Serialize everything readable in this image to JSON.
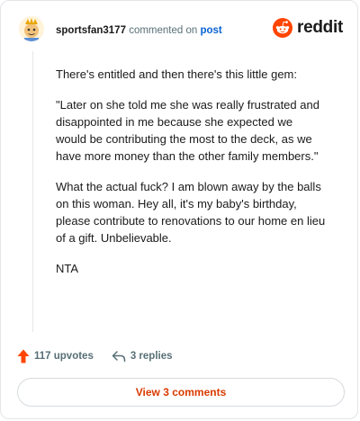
{
  "comment": {
    "author": "sportsfan3177",
    "action_text": "commented on",
    "target_link": "post",
    "paragraphs": [
      "There's entitled and then there's this little gem:",
      "\"Later on she told me she was really frustrated and disappointed in me because she expected we would be contributing the most to the deck, as we have more money than the other family members.\"",
      "What the actual fuck? I am blown away by the balls on this woman. Hey all, it's my baby's birthday, please contribute to renovations to our home en lieu of a gift. Unbelievable.",
      "NTA"
    ]
  },
  "brand": {
    "wordmark": "reddit",
    "logo_icon": "reddit-snoo-icon",
    "accent": "#ff4500"
  },
  "actions": {
    "upvotes": "117 upvotes",
    "replies": "3 replies",
    "upvote_icon": "upvote-arrow-icon",
    "reply_icon": "reply-arrow-icon"
  },
  "footer": {
    "view_comments": "View 3 comments",
    "view_color": "#d93a00"
  }
}
